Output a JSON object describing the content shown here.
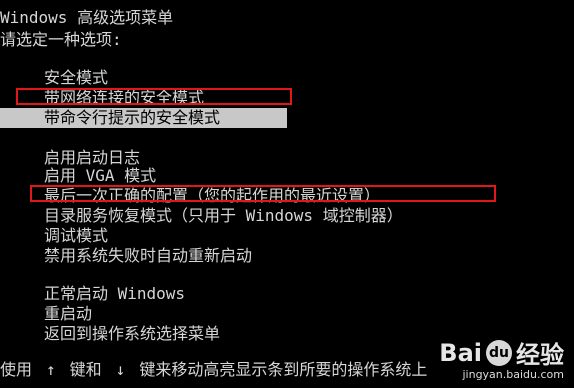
{
  "header": {
    "title": "Windows 高级选项菜单",
    "prompt": "请选定一种选项:"
  },
  "menu": {
    "group1": [
      {
        "label": "安全模式"
      },
      {
        "label": "带网络连接的安全模式"
      },
      {
        "label": "带命令行提示的安全模式"
      }
    ],
    "group2": [
      {
        "label": "启用启动日志"
      },
      {
        "label": "启用 VGA 模式"
      },
      {
        "label": "最后一次正确的配置（您的起作用的最近设置）"
      },
      {
        "label": "目录服务恢复模式（只用于 Windows 域控制器）"
      },
      {
        "label": "调试模式"
      },
      {
        "label": "禁用系统失败时自动重新启动"
      }
    ],
    "group3": [
      {
        "label": "正常启动 Windows"
      },
      {
        "label": "重启动"
      },
      {
        "label": "返回到操作系统选择菜单"
      }
    ]
  },
  "footer": {
    "prefix": "使用",
    "up_arrow": "↑",
    "middle": "键和",
    "down_arrow": "↓",
    "suffix": "键来移动高亮显示条到所要的操作系统上"
  },
  "watermark": {
    "brand_left": "Bai",
    "paw": "du",
    "brand_right": "经验",
    "url": "jingyan.baidu.com"
  },
  "colors": {
    "background": "#000000",
    "text": "#d6d6d6",
    "highlight": "#c8c8c8",
    "annotation": "#e01818"
  }
}
